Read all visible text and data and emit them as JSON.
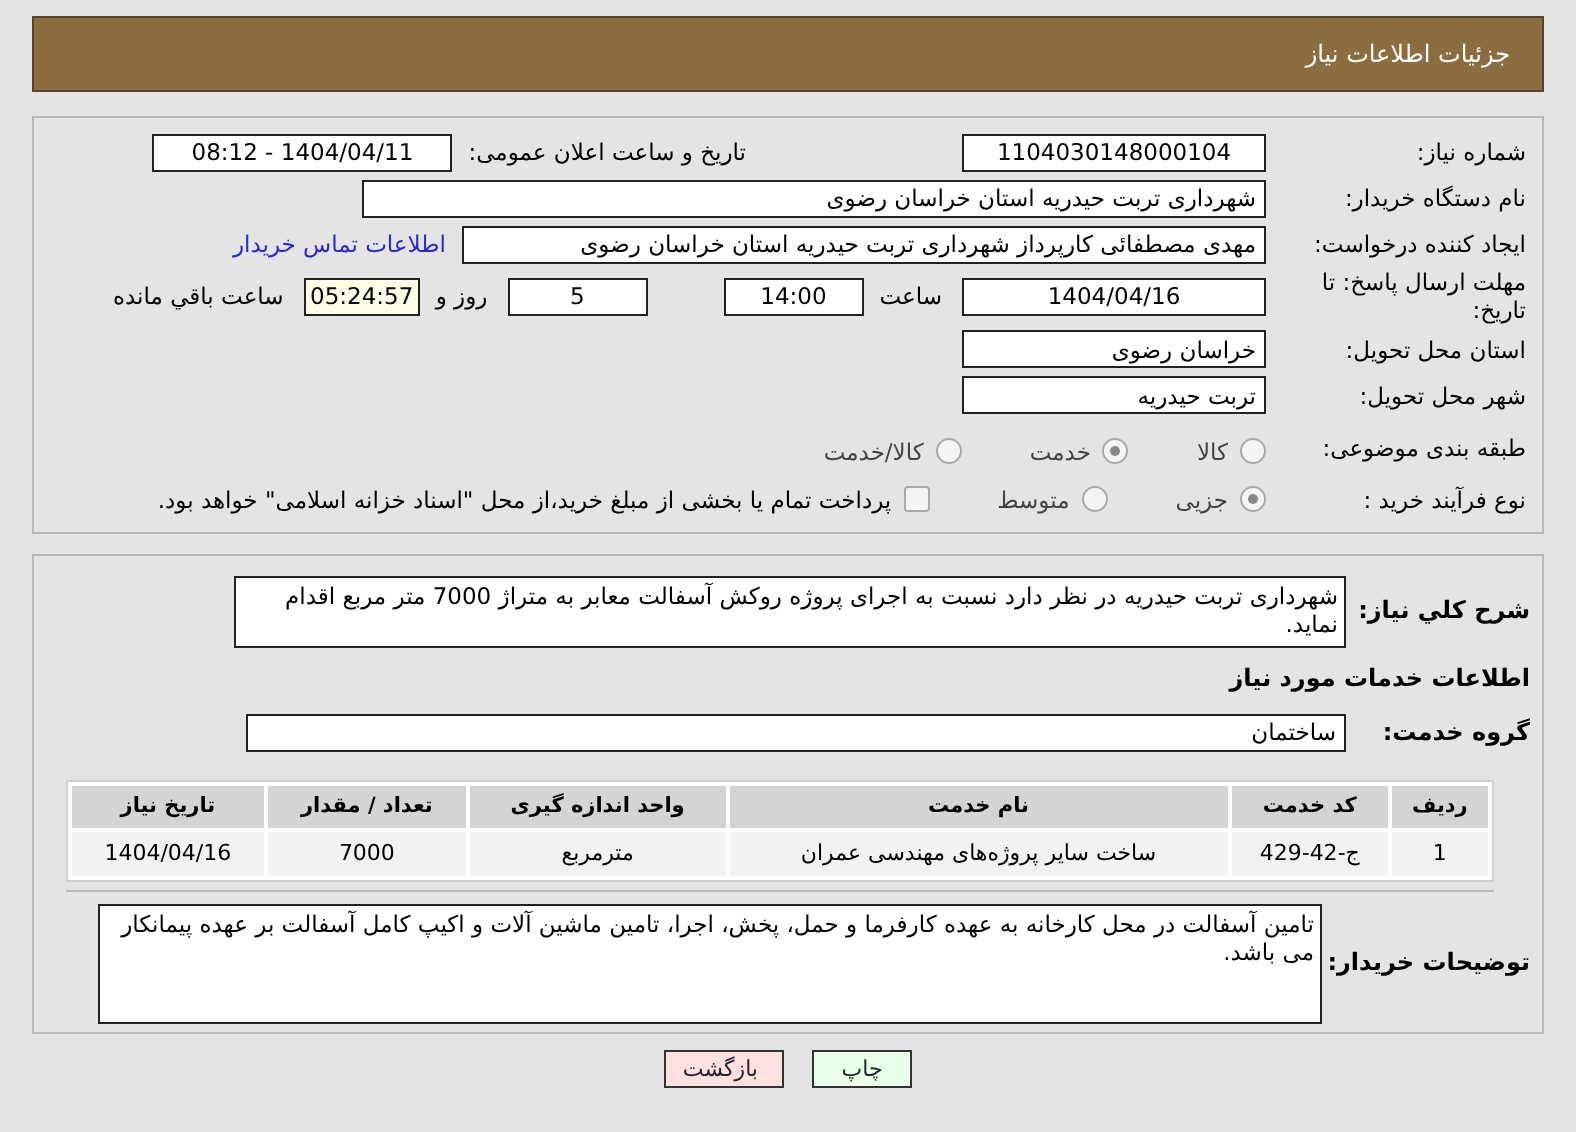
{
  "header": {
    "title": "جزئیات اطلاعات نیاز"
  },
  "need_number": {
    "label": "شماره نیاز:",
    "value": "1104030148000104"
  },
  "announce": {
    "label": "تاریخ و ساعت اعلان عمومی:",
    "value": "1404/04/11 - 08:12"
  },
  "buyer": {
    "label": "نام دستگاه خریدار:",
    "value": "شهرداری تربت حیدریه استان خراسان رضوی"
  },
  "creator": {
    "label": "ایجاد کننده درخواست:",
    "value": "مهدی مصطفائی کارپرداز شهرداری تربت حیدریه استان خراسان رضوی",
    "link": "اطلاعات تماس خریدار"
  },
  "deadline": {
    "label": "مهلت ارسال پاسخ: تا تاریخ:",
    "date": "1404/04/16",
    "time_label": "ساعت",
    "time": "14:00",
    "days": "5",
    "days_label": "روز و",
    "remaining": "05:24:57",
    "remaining_label": "ساعت باقي مانده"
  },
  "province": {
    "label": "استان محل تحویل:",
    "value": "خراسان رضوی"
  },
  "city": {
    "label": "شهر محل تحویل:",
    "value": "تربت حیدریه"
  },
  "category": {
    "label": "طبقه بندی موضوعی:",
    "options": [
      {
        "label": "کالا",
        "selected": false
      },
      {
        "label": "خدمت",
        "selected": true
      },
      {
        "label": "کالا/خدمت",
        "selected": false
      }
    ]
  },
  "process": {
    "label": "نوع فرآیند خرید :",
    "options": [
      {
        "label": "جزیی",
        "selected": true
      },
      {
        "label": "متوسط",
        "selected": false
      }
    ],
    "payment": {
      "checked": false,
      "text": "پرداخت تمام یا بخشی از مبلغ خرید،از محل \"اسناد خزانه اسلامی\" خواهد بود."
    }
  },
  "summary": {
    "label": "شرح کلي نیاز:",
    "value": "شهرداری تربت حیدریه در نظر دارد نسبت به اجرای پروژه روکش آسفالت معابر به متراژ 7000 متر مربع اقدام نماید."
  },
  "services_heading": "اطلاعات خدمات مورد نیاز",
  "service_group": {
    "label": "گروه خدمت:",
    "value": "ساختمان"
  },
  "table": {
    "columns": [
      "ردیف",
      "کد خدمت",
      "نام خدمت",
      "واحد اندازه گیری",
      "تعداد / مقدار",
      "تاریخ نیاز"
    ],
    "rows": [
      [
        "1",
        "ج-42-429",
        "ساخت سایر پروژه‌های مهندسی عمران",
        "مترمربع",
        "7000",
        "1404/04/16"
      ]
    ]
  },
  "buyer_notes": {
    "label": "توضیحات خریدار:",
    "value": "تامین آسفالت در محل کارخانه به عهده کارفرما و حمل، پخش، اجرا، تامین ماشین آلات و اکیپ کامل آسفالت بر عهده پیمانکار می باشد."
  },
  "buttons": [
    {
      "label": "چاپ",
      "kind": "print"
    },
    {
      "label": "بازگشت",
      "kind": "back"
    }
  ]
}
